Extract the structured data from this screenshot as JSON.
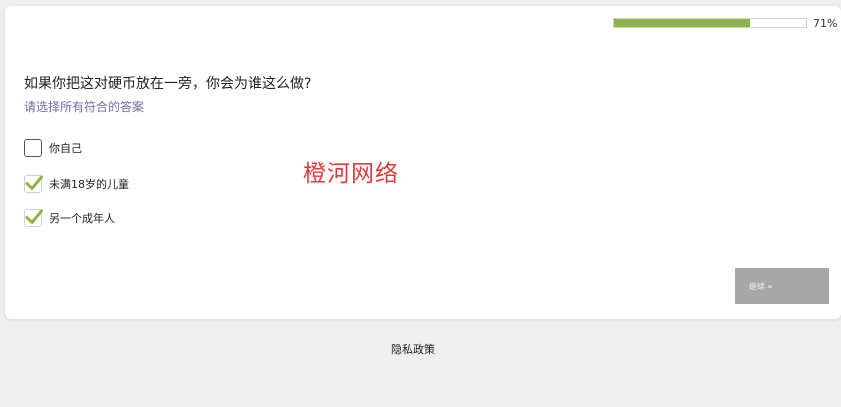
{
  "progress": {
    "percent": 71,
    "label": "71%",
    "fill_color": "#8db449"
  },
  "question": {
    "text": "如果你把这对硬币放在一旁，你会为谁这么做?",
    "instruction": "请选择所有符合的答案"
  },
  "options": [
    {
      "label": "你自己",
      "checked": false
    },
    {
      "label": "未满18岁的儿童",
      "checked": true
    },
    {
      "label": "另一个成年人",
      "checked": true
    }
  ],
  "watermark": "橙河网络",
  "next_button": {
    "label": "继续 »"
  },
  "footer": {
    "privacy_label": "隐私政策"
  },
  "colors": {
    "check": "#8db449",
    "instruction": "#6b6fa8",
    "watermark": "#e03a3a",
    "button_bg": "#a7a7a7"
  }
}
